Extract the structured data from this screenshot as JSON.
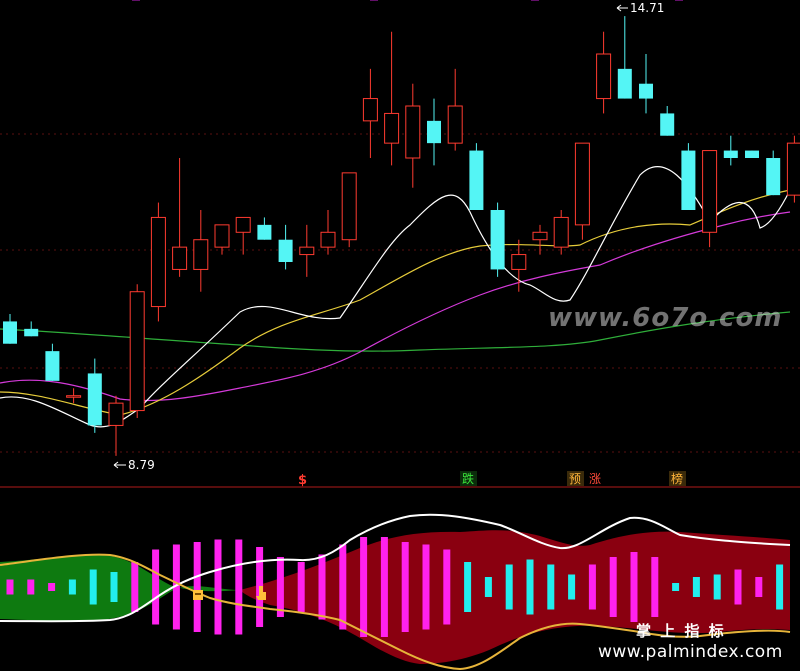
{
  "labels": {
    "high_price": "14.71",
    "low_price": "8.79",
    "sig_dollar": "$",
    "sig_die": "跌",
    "sig_yu": "预",
    "sig_zhang": "涨",
    "sig_bang": "榜",
    "watermark_top": "www.6o7o.com",
    "watermark_cn": "掌 上 指 标",
    "watermark_bottom": "www.palmindex.com"
  },
  "colors": {
    "up": "#ff3b30",
    "down": "#54f5f5",
    "ma5": "#ffffff",
    "ma10": "#e6cc3a",
    "ma20": "#d43ad9",
    "ma60": "#2fae3a",
    "bar_magenta": "#ff22ee",
    "bar_cyan": "#22eeee",
    "band_green": "#0e7a10",
    "band_red": "#8a0010",
    "grid": "#5a1010",
    "divider": "#b01a1a"
  },
  "chart_data": {
    "type": "candlestick",
    "candles": [
      {
        "o": 10.6,
        "h": 10.7,
        "l": 10.3,
        "c": 10.3
      },
      {
        "o": 10.5,
        "h": 10.6,
        "l": 10.4,
        "c": 10.4
      },
      {
        "o": 10.2,
        "h": 10.3,
        "l": 9.8,
        "c": 9.8
      },
      {
        "o": 9.6,
        "h": 9.7,
        "l": 9.5,
        "c": 9.6
      },
      {
        "o": 9.9,
        "h": 10.1,
        "l": 9.1,
        "c": 9.2
      },
      {
        "o": 9.2,
        "h": 9.6,
        "l": 8.79,
        "c": 9.5
      },
      {
        "o": 9.4,
        "h": 11.1,
        "l": 9.3,
        "c": 11.0
      },
      {
        "o": 10.8,
        "h": 12.2,
        "l": 10.6,
        "c": 12.0
      },
      {
        "o": 11.3,
        "h": 12.8,
        "l": 11.2,
        "c": 11.6
      },
      {
        "o": 11.3,
        "h": 12.1,
        "l": 11.0,
        "c": 11.7
      },
      {
        "o": 11.6,
        "h": 11.9,
        "l": 11.5,
        "c": 11.9
      },
      {
        "o": 11.8,
        "h": 12.0,
        "l": 11.5,
        "c": 12.0
      },
      {
        "o": 11.9,
        "h": 12.0,
        "l": 11.7,
        "c": 11.7
      },
      {
        "o": 11.7,
        "h": 11.9,
        "l": 11.3,
        "c": 11.4
      },
      {
        "o": 11.5,
        "h": 11.9,
        "l": 11.2,
        "c": 11.6
      },
      {
        "o": 11.6,
        "h": 12.1,
        "l": 11.5,
        "c": 11.8
      },
      {
        "o": 11.7,
        "h": 12.6,
        "l": 11.6,
        "c": 12.6
      },
      {
        "o": 13.3,
        "h": 14.0,
        "l": 12.8,
        "c": 13.6
      },
      {
        "o": 13.0,
        "h": 14.5,
        "l": 12.7,
        "c": 13.4
      },
      {
        "o": 12.8,
        "h": 13.8,
        "l": 12.4,
        "c": 13.5
      },
      {
        "o": 13.3,
        "h": 13.6,
        "l": 12.7,
        "c": 13.0
      },
      {
        "o": 13.0,
        "h": 14.0,
        "l": 12.9,
        "c": 13.5
      },
      {
        "o": 12.9,
        "h": 13.0,
        "l": 12.2,
        "c": 12.1
      },
      {
        "o": 12.1,
        "h": 12.2,
        "l": 11.2,
        "c": 11.3
      },
      {
        "o": 11.3,
        "h": 11.7,
        "l": 11.0,
        "c": 11.5
      },
      {
        "o": 11.7,
        "h": 11.9,
        "l": 11.5,
        "c": 11.8
      },
      {
        "o": 11.6,
        "h": 12.1,
        "l": 11.5,
        "c": 12.0
      },
      {
        "o": 11.9,
        "h": 13.0,
        "l": 11.7,
        "c": 13.0
      },
      {
        "o": 13.6,
        "h": 14.5,
        "l": 13.4,
        "c": 14.2
      },
      {
        "o": 14.0,
        "h": 14.71,
        "l": 13.6,
        "c": 13.6
      },
      {
        "o": 13.8,
        "h": 14.2,
        "l": 13.4,
        "c": 13.6
      },
      {
        "o": 13.4,
        "h": 13.5,
        "l": 13.1,
        "c": 13.1
      },
      {
        "o": 12.9,
        "h": 13.0,
        "l": 12.1,
        "c": 12.1
      },
      {
        "o": 11.8,
        "h": 12.9,
        "l": 11.6,
        "c": 12.9
      },
      {
        "o": 12.9,
        "h": 13.1,
        "l": 12.7,
        "c": 12.8
      },
      {
        "o": 12.9,
        "h": 12.9,
        "l": 12.8,
        "c": 12.8
      },
      {
        "o": 12.8,
        "h": 12.9,
        "l": 12.3,
        "c": 12.3
      },
      {
        "o": 12.3,
        "h": 13.1,
        "l": 12.2,
        "c": 13.0
      }
    ],
    "indicator_bars": [
      {
        "type": "magenta",
        "v": 0.15
      },
      {
        "type": "magenta",
        "v": 0.15
      },
      {
        "type": "magenta",
        "v": 0.08
      },
      {
        "type": "cyan",
        "v": 0.15
      },
      {
        "type": "cyan",
        "v": 0.35
      },
      {
        "type": "cyan",
        "v": 0.3
      },
      {
        "type": "magenta",
        "v": 0.5
      },
      {
        "type": "magenta",
        "v": 0.75
      },
      {
        "type": "magenta",
        "v": 0.85
      },
      {
        "type": "magenta",
        "v": 0.9
      },
      {
        "type": "magenta",
        "v": 0.95
      },
      {
        "type": "magenta",
        "v": 0.95
      },
      {
        "type": "magenta",
        "v": 0.8
      },
      {
        "type": "magenta",
        "v": 0.6
      },
      {
        "type": "magenta",
        "v": 0.5
      },
      {
        "type": "magenta",
        "v": 0.65
      },
      {
        "type": "magenta",
        "v": 0.85
      },
      {
        "type": "magenta",
        "v": 1.0
      },
      {
        "type": "magenta",
        "v": 1.0
      },
      {
        "type": "magenta",
        "v": 0.9
      },
      {
        "type": "magenta",
        "v": 0.85
      },
      {
        "type": "magenta",
        "v": 0.75
      },
      {
        "type": "cyan",
        "v": 0.5
      },
      {
        "type": "cyan",
        "v": 0.2
      },
      {
        "type": "cyan",
        "v": 0.45
      },
      {
        "type": "cyan",
        "v": 0.55
      },
      {
        "type": "cyan",
        "v": 0.45
      },
      {
        "type": "cyan",
        "v": 0.25
      },
      {
        "type": "magenta",
        "v": 0.45
      },
      {
        "type": "magenta",
        "v": 0.6
      },
      {
        "type": "magenta",
        "v": 0.7
      },
      {
        "type": "magenta",
        "v": 0.6
      },
      {
        "type": "cyan",
        "v": 0.08
      },
      {
        "type": "cyan",
        "v": 0.2
      },
      {
        "type": "cyan",
        "v": 0.25
      },
      {
        "type": "magenta",
        "v": 0.35
      },
      {
        "type": "magenta",
        "v": 0.2
      },
      {
        "type": "cyan",
        "v": 0.45
      }
    ]
  }
}
